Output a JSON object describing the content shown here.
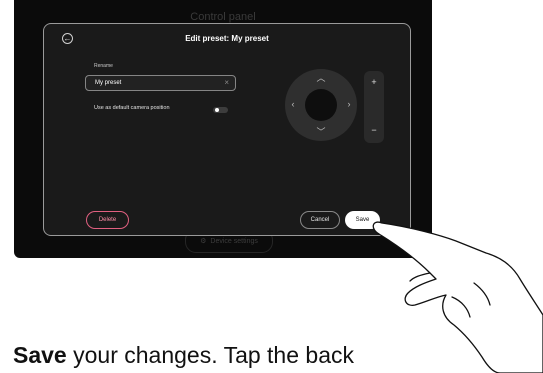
{
  "background": {
    "title": "Control panel",
    "bottom_label": "Device settings"
  },
  "dialog": {
    "title": "Edit preset: My preset",
    "rename_label": "Rename",
    "rename_value": "My preset",
    "default_position_label": "Use as default camera position",
    "default_position_on": false,
    "delete_label": "Delete",
    "cancel_label": "Cancel",
    "save_label": "Save"
  },
  "camera_controls": {
    "zoom_in": "+",
    "zoom_out": "−"
  },
  "caption": {
    "bold": "Save",
    "text": " your changes. Tap the back"
  },
  "colors": {
    "delete_accent": "#e06080",
    "panel": "#1a1a1a"
  }
}
